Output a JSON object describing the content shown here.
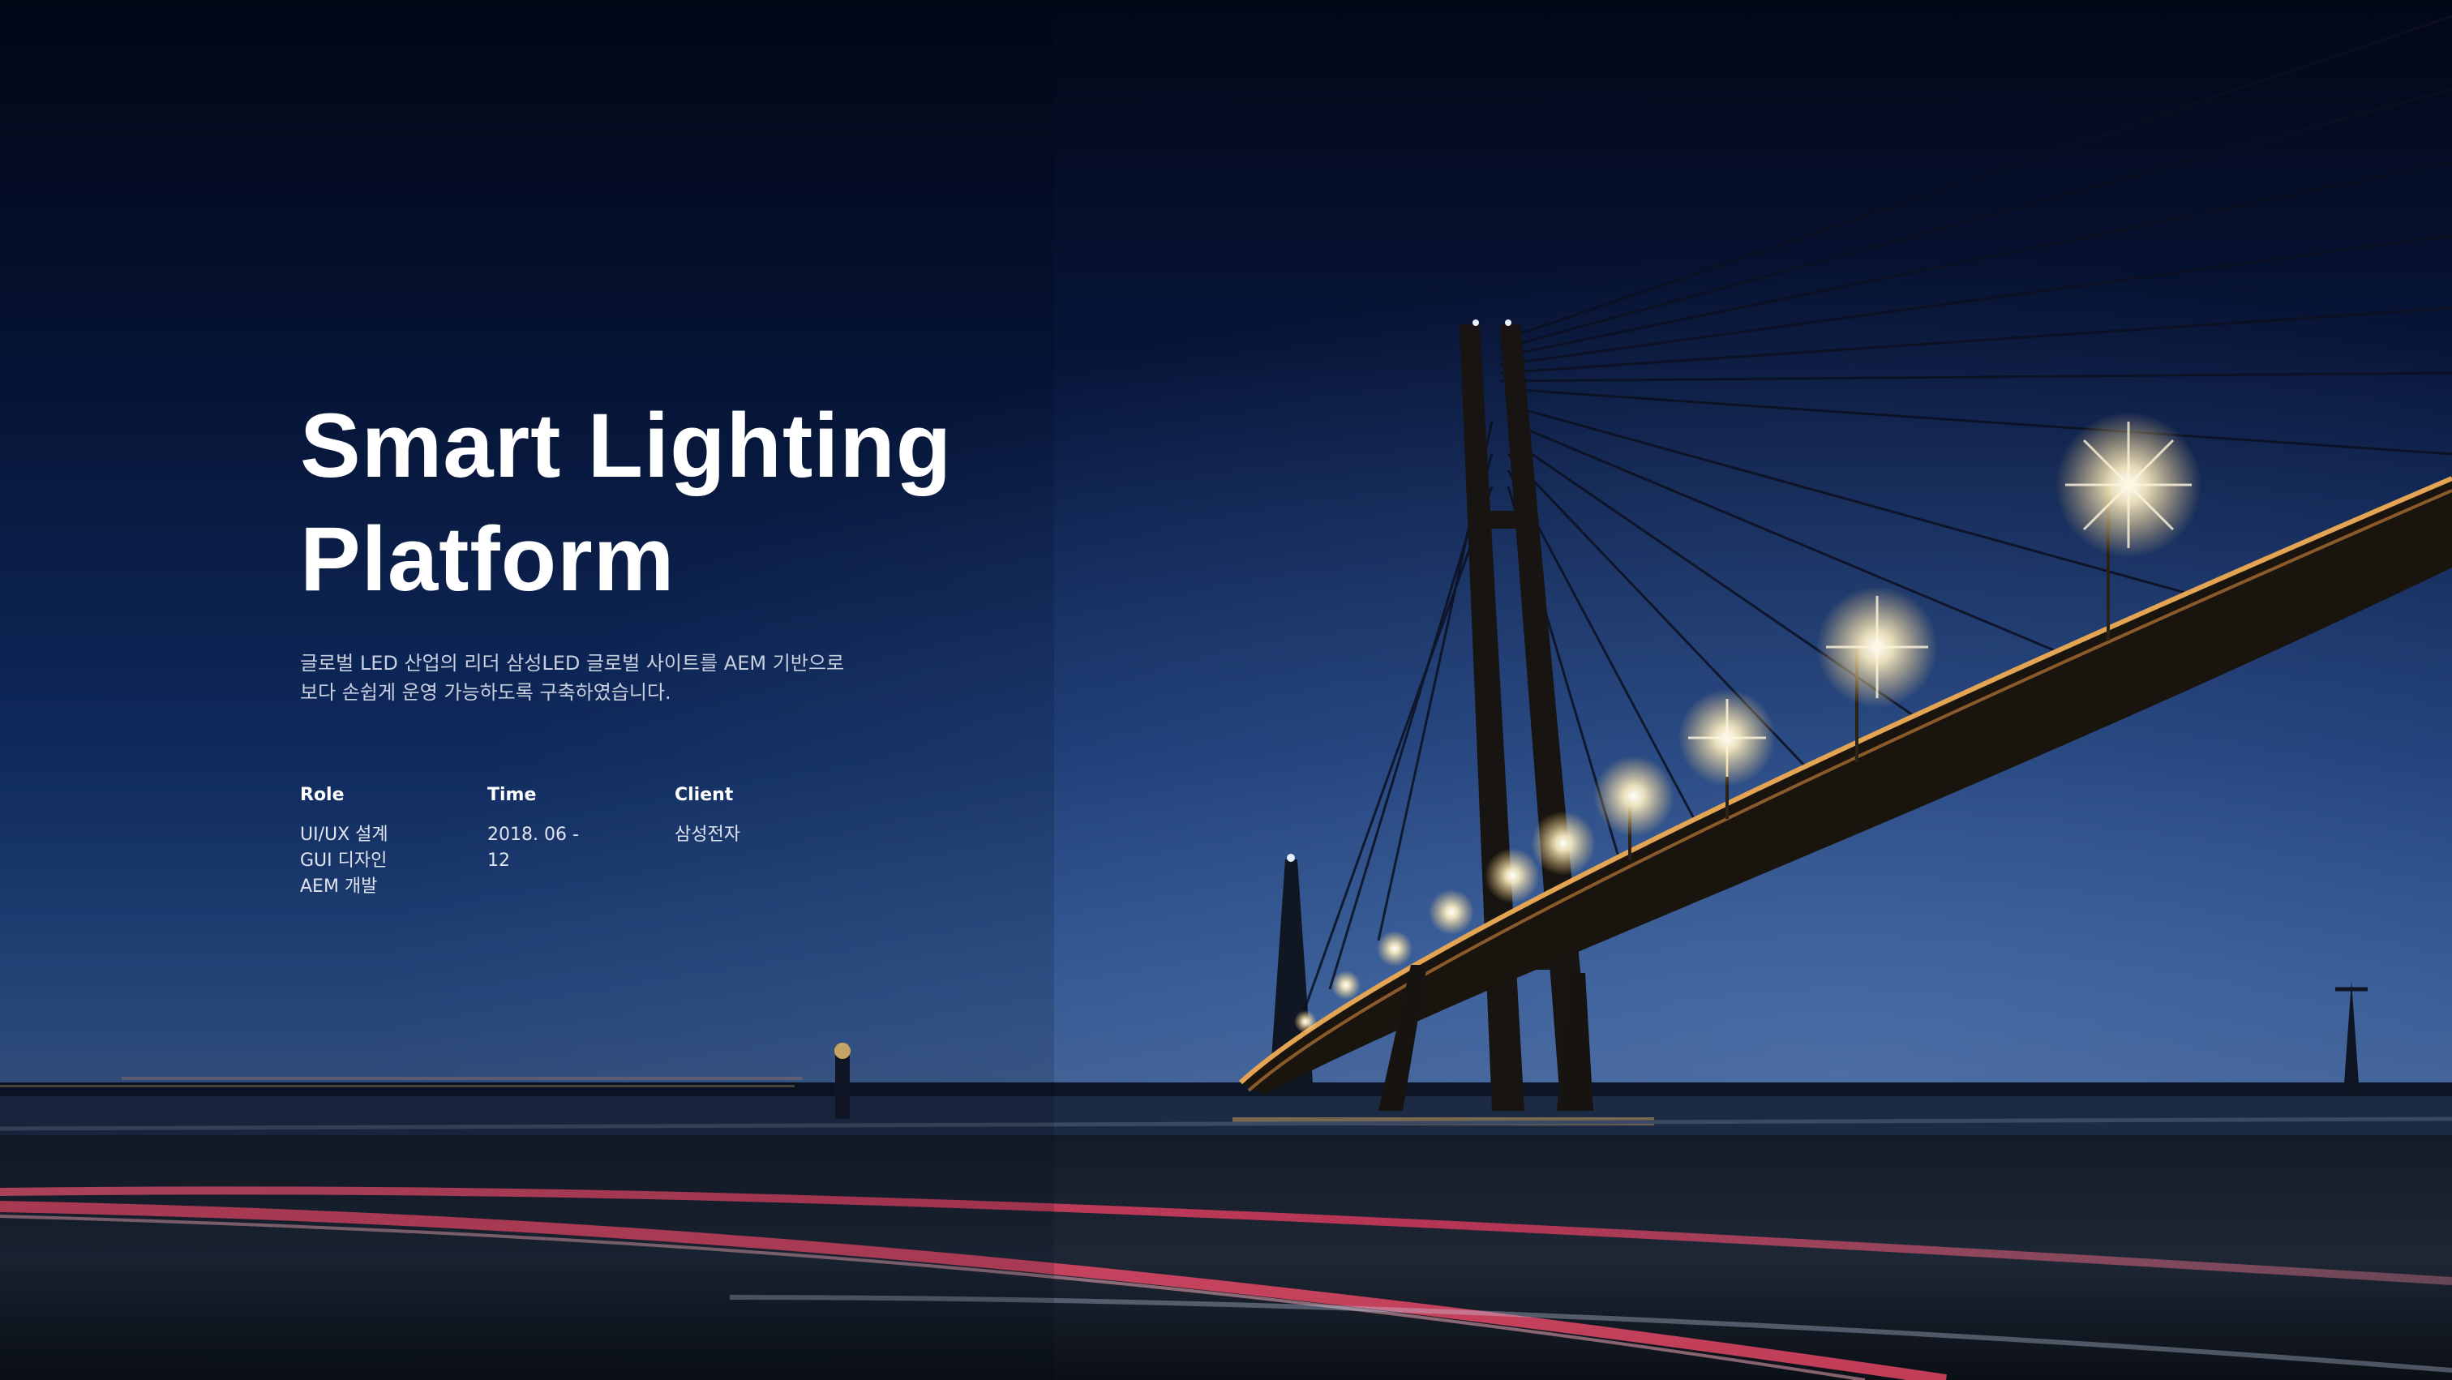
{
  "hero": {
    "title_line1": "Smart Lighting",
    "title_line2": "Platform",
    "description_line1": "글로벌 LED 산업의 리더 삼성LED 글로벌 사이트를 AEM 기반으로",
    "description_line2": "보다 손쉽게 운영 가능하도록 구축하였습니다."
  },
  "meta": {
    "role": {
      "label": "Role",
      "values": [
        "UI/UX 설계",
        "GUI 디자인",
        "AEM 개발"
      ]
    },
    "time": {
      "label": "Time",
      "values": [
        "2018. 06 -",
        "12"
      ]
    },
    "client": {
      "label": "Client",
      "values": [
        "삼성전자"
      ]
    }
  },
  "colors": {
    "sky_top": "#040a1f",
    "sky_mid": "#0f2a5c",
    "horizon": "#4a6ea8",
    "light_trail": "#ff4d6d",
    "lamp": "#ffe9b0",
    "text": "#ffffff"
  },
  "icons": {
    "background": "cable-stayed-bridge-night-photo"
  }
}
